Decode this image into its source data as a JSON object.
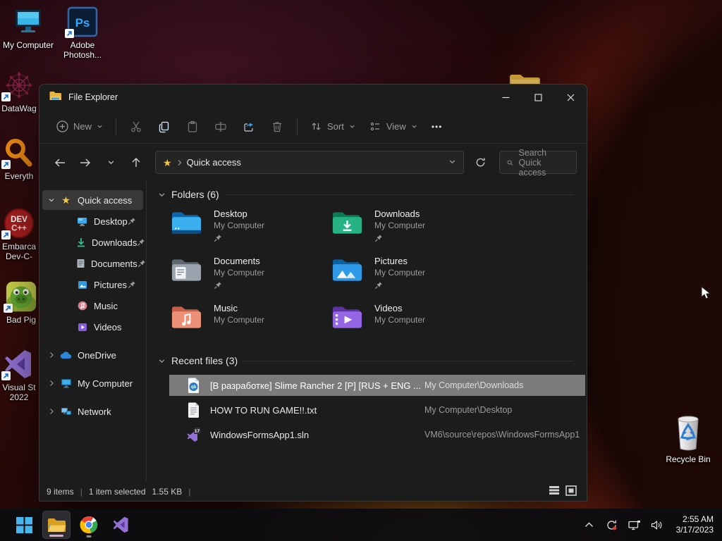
{
  "desktop": {
    "icons": {
      "my_computer": "My Computer",
      "photoshop_line1": "Adobe",
      "photoshop_line2": "Photosh...",
      "datawagon": "DataWag",
      "everything": "Everyth",
      "devcpp_line1": "Embarca",
      "devcpp_line2": "Dev-C-",
      "bad_piggies": "Bad Pig",
      "visual_studio_line1": "Visual St",
      "visual_studio_line2": "2022",
      "recycle_bin": "Recycle Bin"
    }
  },
  "icon_text": {
    "ps": "Ps",
    "dev1": "DEV",
    "dev2": "C++",
    "qb": "qb",
    "sln_badge": "17"
  },
  "window": {
    "title": "File Explorer",
    "toolbar": {
      "new": "New",
      "sort": "Sort",
      "view": "View",
      "more": "•••"
    },
    "addressbar": {
      "path": "Quick access",
      "search_placeholder": "Search Quick access"
    },
    "sidebar": {
      "quick_access": "Quick access",
      "items": [
        {
          "label": "Desktop",
          "pinned": true
        },
        {
          "label": "Downloads",
          "pinned": true
        },
        {
          "label": "Documents",
          "pinned": true
        },
        {
          "label": "Pictures",
          "pinned": true
        },
        {
          "label": "Music",
          "pinned": false
        },
        {
          "label": "Videos",
          "pinned": false
        }
      ],
      "onedrive": "OneDrive",
      "my_computer": "My Computer",
      "network": "Network"
    },
    "folders": {
      "header": "Folders (6)",
      "items": [
        {
          "name": "Desktop",
          "location": "My Computer",
          "pinned": true
        },
        {
          "name": "Downloads",
          "location": "My Computer",
          "pinned": true
        },
        {
          "name": "Documents",
          "location": "My Computer",
          "pinned": true
        },
        {
          "name": "Pictures",
          "location": "My Computer",
          "pinned": true
        },
        {
          "name": "Music",
          "location": "My Computer",
          "pinned": false
        },
        {
          "name": "Videos",
          "location": "My Computer",
          "pinned": false
        }
      ]
    },
    "recent": {
      "header": "Recent files (3)",
      "items": [
        {
          "name": "[В разработке] Slime Rancher 2 [P] [RUS + ENG ...",
          "location": "My Computer\\Downloads",
          "selected": true
        },
        {
          "name": "HOW TO RUN GAME!!.txt",
          "location": "My Computer\\Desktop",
          "selected": false
        },
        {
          "name": "WindowsFormsApp1.sln",
          "location": "VM6\\source\\repos\\WindowsFormsApp1",
          "selected": false
        }
      ]
    },
    "statusbar": {
      "count": "9 items",
      "selected": "1 item selected",
      "size": "1.55 KB"
    }
  },
  "taskbar": {
    "time": "2:55 AM",
    "date": "3/17/2023"
  },
  "colors": {
    "accent_blue": "#4cc2ff",
    "star_yellow": "#f6c83d",
    "selection_gray": "#7b7b7b",
    "share_blue": "#3b9ae8",
    "wallpaper_red": "#cd4420"
  }
}
